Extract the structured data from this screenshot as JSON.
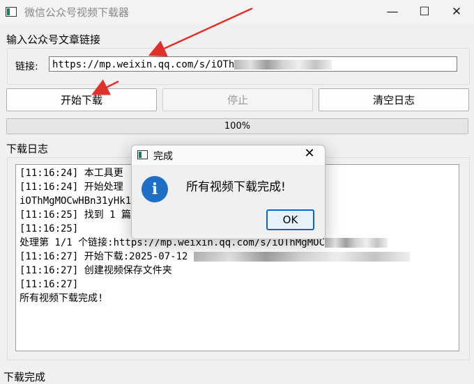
{
  "window": {
    "title": "微信公众号视频下载器"
  },
  "url_group": {
    "label": "输入公众号文章链接",
    "field_label": "链接:",
    "value": "https://mp.weixin.qq.com/s/iOTh"
  },
  "buttons": {
    "start": "开始下载",
    "stop": "停止",
    "clear": "清空日志"
  },
  "progress": {
    "value": 1.0,
    "text": "100%"
  },
  "log": {
    "label": "下载日志",
    "lines": [
      "[11:16:24] 本工具更",
      "[11:16:24] 开始处理",
      "iOThMgMOCwHBn31yHk1",
      "[11:16:25] 找到 1 篇",
      "[11:16:25]",
      "处理第 1/1 个链接:https://mp.weixin.qq.com/s/iOThMgMOC",
      "[11:16:27] 开始下载:2025-07-12",
      "[11:16:27] 创建视频保存文件夹",
      "[11:16:27]",
      "所有视频下载完成!"
    ]
  },
  "status_bar": {
    "text": "下载完成"
  },
  "dialog": {
    "title": "完成",
    "message": "所有视频下载完成!",
    "ok": "OK",
    "icon": "info-icon"
  },
  "colors": {
    "accent": "#0067c0",
    "arrow": "#e0302a",
    "info": "#1f6fc6"
  }
}
